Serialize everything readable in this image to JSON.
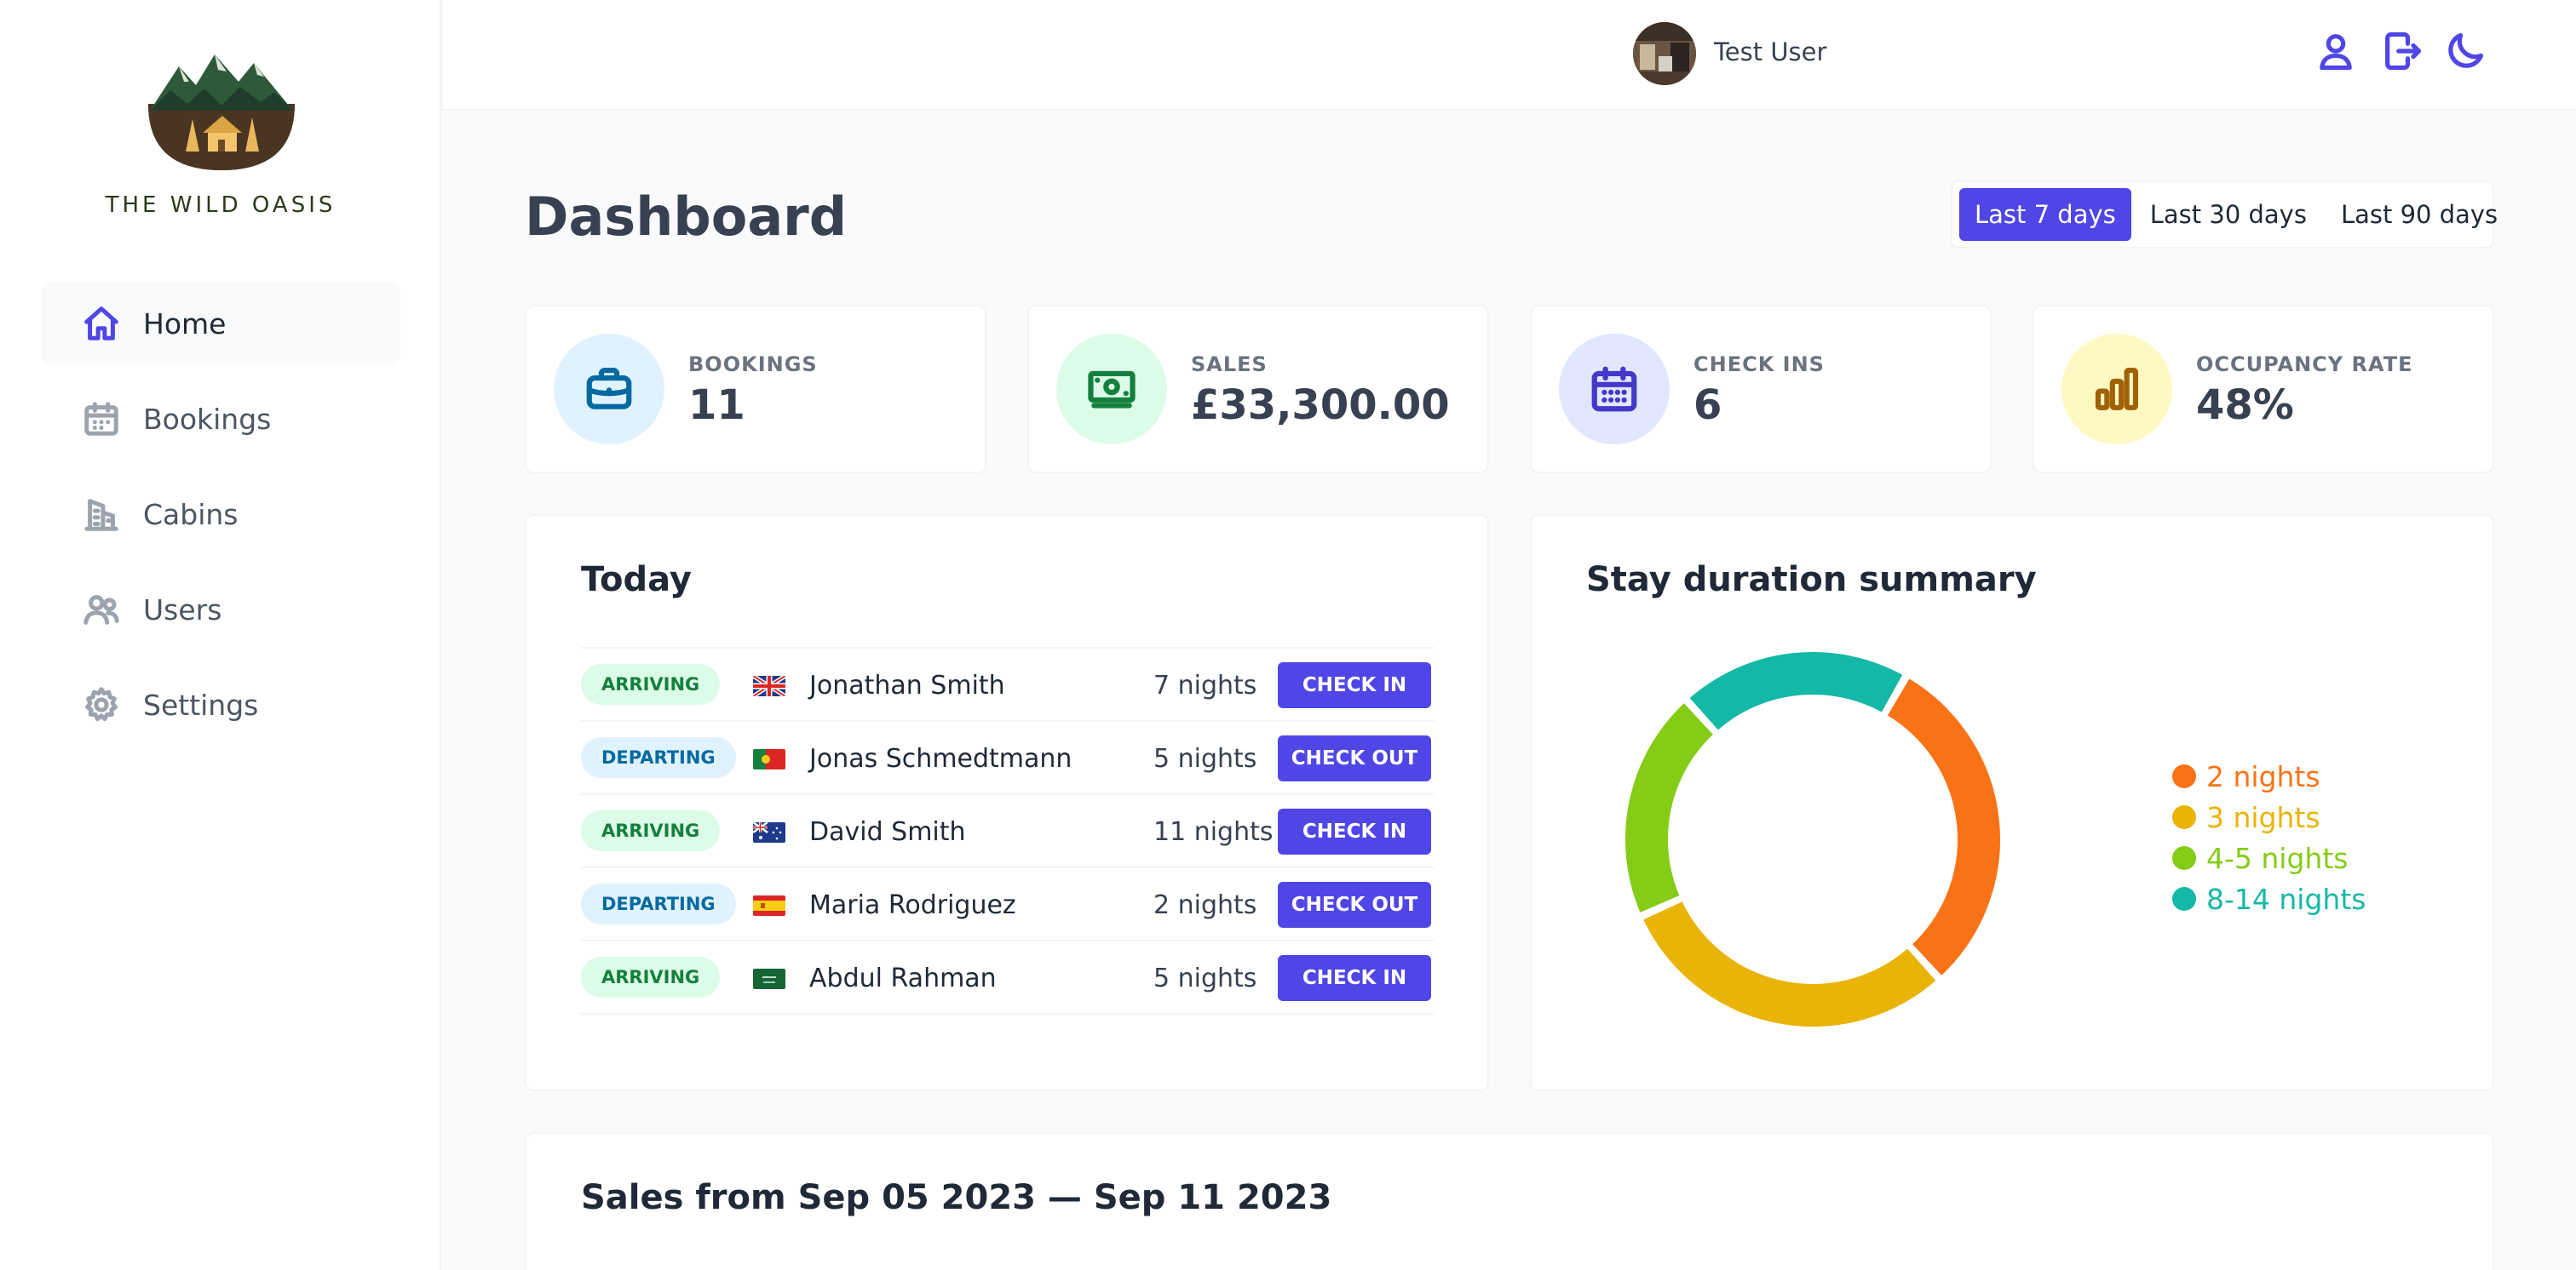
{
  "sidebar": {
    "brand": "THE WILD OASIS",
    "items": [
      {
        "label": "Home",
        "icon": "home-icon"
      },
      {
        "label": "Bookings",
        "icon": "calendar-icon"
      },
      {
        "label": "Cabins",
        "icon": "building-icon"
      },
      {
        "label": "Users",
        "icon": "users-icon"
      },
      {
        "label": "Settings",
        "icon": "gear-icon"
      }
    ],
    "active": "Home"
  },
  "header": {
    "username": "Test User",
    "icons": [
      "user-icon",
      "logout-icon",
      "moon-icon"
    ]
  },
  "main": {
    "title": "Dashboard",
    "filters": [
      "Last 7 days",
      "Last 30 days",
      "Last 90 days"
    ],
    "active_filter": "Last 7 days",
    "stats": [
      {
        "label": "BOOKINGS",
        "value": "11",
        "icon": "briefcase-icon",
        "color": "#0369a1",
        "bg": "#e0f2fe"
      },
      {
        "label": "SALES",
        "value": "£33,300.00",
        "icon": "banknotes-icon",
        "color": "#15803d",
        "bg": "#dcfce7"
      },
      {
        "label": "CHECK INS",
        "value": "6",
        "icon": "calendar-days-icon",
        "color": "#4338ca",
        "bg": "#e0e7ff"
      },
      {
        "label": "OCCUPANCY RATE",
        "value": "48%",
        "icon": "chart-bar-icon",
        "color": "#a16207",
        "bg": "#fef9c3"
      }
    ],
    "today": {
      "title": "Today",
      "rows": [
        {
          "status": "ARRIVING",
          "country": "gb",
          "guest": "Jonathan Smith",
          "nights": "7 nights",
          "action": "CHECK IN"
        },
        {
          "status": "DEPARTING",
          "country": "pt",
          "guest": "Jonas Schmedtmann",
          "nights": "5 nights",
          "action": "CHECK OUT"
        },
        {
          "status": "ARRIVING",
          "country": "au",
          "guest": "David Smith",
          "nights": "11 nights",
          "action": "CHECK IN"
        },
        {
          "status": "DEPARTING",
          "country": "es",
          "guest": "Maria Rodriguez",
          "nights": "2 nights",
          "action": "CHECK OUT"
        },
        {
          "status": "ARRIVING",
          "country": "sa",
          "guest": "Abdul Rahman",
          "nights": "5 nights",
          "action": "CHECK IN"
        }
      ]
    },
    "duration": {
      "title": "Stay duration summary"
    },
    "sales": {
      "title": "Sales from Sep 05 2023 — Sep 11 2023"
    }
  },
  "chart_data": {
    "type": "pie",
    "categories": [
      "2 nights",
      "3 nights",
      "4-5 nights",
      "8-14 nights"
    ],
    "values": [
      3,
      3,
      2,
      2
    ],
    "colors": [
      "#f97316",
      "#eab308",
      "#84cc16",
      "#14b8a6"
    ],
    "donut": true,
    "legend": "right"
  }
}
